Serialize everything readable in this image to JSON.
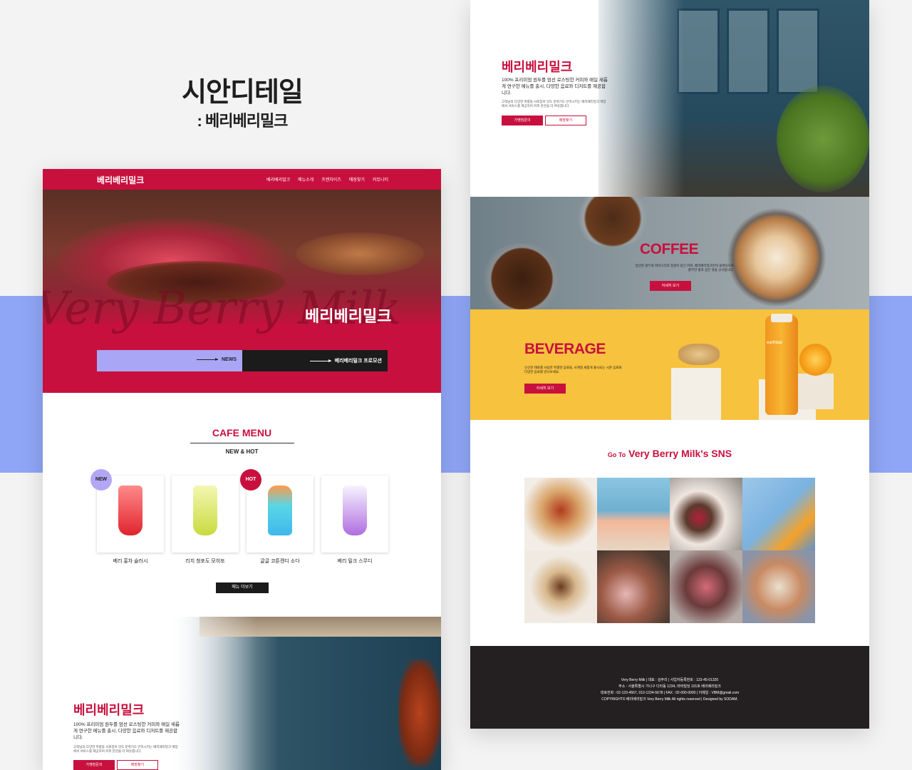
{
  "presentation": {
    "title": "시안디테일",
    "subtitle": ": 베리베리밀크"
  },
  "colors": {
    "brand_red": "#c8103e",
    "lavender": "#a9a6f6",
    "band_blue": "#8fa6f6",
    "dark": "#1b1b1b",
    "beverage_yellow": "#f7c23d"
  },
  "left_mock": {
    "nav": {
      "brand": "베리베리밀크",
      "items": [
        "베리베리밀크",
        "메뉴소개",
        "프랜차이즈",
        "매장찾기",
        "커뮤니티"
      ]
    },
    "hero": {
      "script_text": "Very Berry Milk",
      "title": "베리베리밀크",
      "news_button": "NEWS",
      "promo_button": "베리베리밀크 프로모션"
    },
    "cafe_menu": {
      "title": "CAFE MENU",
      "subtitle": "NEW & HOT",
      "badges": {
        "new": "NEW",
        "hot": "HOT"
      },
      "items": [
        {
          "name": "베리 홍차 슬러시",
          "icon": "red-slush-drink-icon"
        },
        {
          "name": "리치 청포도 모히또",
          "icon": "green-mojito-drink-icon"
        },
        {
          "name": "글글 코튼캔디 소다",
          "icon": "blue-soda-drink-icon"
        },
        {
          "name": "베리 밀크 스무디",
          "icon": "purple-smoothie-drink-icon"
        }
      ],
      "more_button": "메뉴 더보기"
    },
    "brand_section": {
      "title": "베리베리밀크",
      "description": "100% 프리미엄 원두를 엄선 로스팅한 커피와 매일 새롭게 연구한 메뉴를 출시, 다양한 음료와 디저트를 제공합니다.",
      "small_text": "고객님의 다양한 취향을 사로잡아 맛도 분위기도 만족시키는 베리베리밀크 매장에서 서비스를 제공하며 커피 한잔을 더 여유롭니다.",
      "button_primary": "가맹점문의",
      "button_secondary": "매장찾기"
    }
  },
  "right_mock": {
    "brand_section": {
      "title": "베리베리밀크",
      "description": "100% 프리미엄 원두를 엄선 로스팅한 커피와 매일 새롭게 연구한 메뉴를 출시, 다양한 음료와 디저트를 제공합니다.",
      "small_text": "고객님의 다양한 취향을 사로잡아 맛도 분위기도 만족시키는 베리베리밀크 매장에서 서비스를 제공하며 커피 한잔을 더 여유롭니다.",
      "button_primary": "가맹점문의",
      "button_secondary": "매장찾기"
    },
    "coffee": {
      "title": "COFFEE",
      "description": "엄선된 원두와 바리스타의 정성이 담긴 커피, 베리베리밀크만의 블렌딩으로 풍부한 향과 깊은 맛을 선사합니다.",
      "button": "자세히 보기"
    },
    "beverage": {
      "title": "BEVERAGE",
      "description": "신선한 재료를 사용한 특별한 음료들, 사계절 새롭게 출시되는 시즌 음료와 다양한 음료를 만나보세요.",
      "button": "자세히 보기",
      "bottle_label": "earthbar"
    },
    "sns": {
      "prefix": "Go To",
      "title": "Very Berry Milk's SNS",
      "images": [
        "ice-cream-sundae-photo",
        "peach-drink-beach-photo",
        "cherry-cupcakes-photo",
        "orange-cocktail-photo",
        "hot-chocolate-photo",
        "macaron-dessert-photo",
        "freakshake-photo",
        "pastry-plate-photo"
      ]
    },
    "footer": {
      "lines": [
        "Very Berry Milk  |  대표 : 김주리  |  사업자등록번호 : 123-45-01320",
        "주소 : 서울특별시 가나구 다라동 1234, 마바빌딩 101호 베리베리밀크",
        "대표전화 : 02-123-4567, 010-1234-5678  |  FAX : 02-000-0000  |  이메일 : VBM@gmail.com",
        "COPYRIGHT© 베리베리밀크 Very Berry Milk All rights reserved  |  Designed by SODAM."
      ]
    }
  }
}
